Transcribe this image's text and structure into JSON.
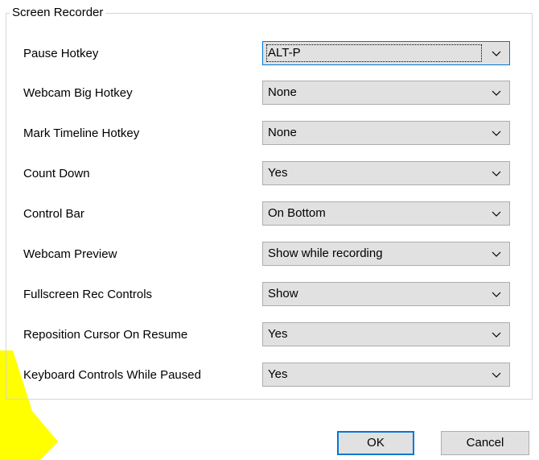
{
  "group": {
    "title": "Screen Recorder"
  },
  "settings": [
    {
      "label": "Pause Hotkey",
      "value": "ALT-P"
    },
    {
      "label": "Webcam Big Hotkey",
      "value": "None"
    },
    {
      "label": "Mark Timeline Hotkey",
      "value": "None"
    },
    {
      "label": "Count Down",
      "value": "Yes"
    },
    {
      "label": "Control Bar",
      "value": "On Bottom"
    },
    {
      "label": "Webcam Preview",
      "value": "Show while recording"
    },
    {
      "label": "Fullscreen Rec Controls",
      "value": "Show"
    },
    {
      "label": "Reposition Cursor On Resume",
      "value": "Yes"
    },
    {
      "label": "Keyboard Controls While Paused",
      "value": "Yes"
    }
  ],
  "buttons": {
    "ok_label": "OK",
    "cancel_label": "Cancel"
  },
  "icons": {
    "dropdown": "chevron-down-icon",
    "annotation": "yellow-arrow-highlight"
  },
  "colors": {
    "highlight": "#ffff00",
    "focus_border": "#0078d7",
    "control_bg": "#e1e1e1"
  }
}
